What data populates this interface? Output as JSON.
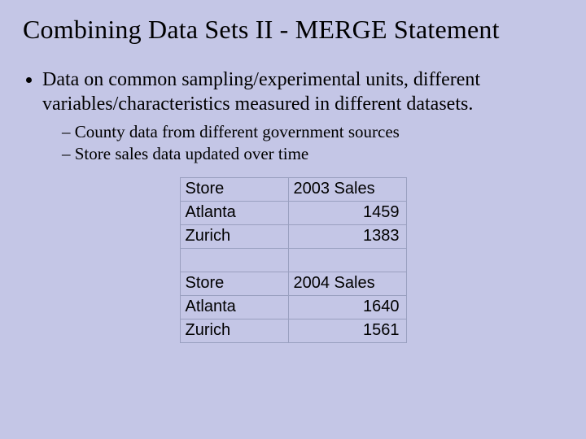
{
  "title": "Combining Data Sets II - MERGE Statement",
  "bullet": "Data on common sampling/experimental units, different variables/characteristics measured in different datasets.",
  "sub1": "County data from different government sources",
  "sub2": "Store sales data updated over time",
  "t": {
    "h1a": "Store",
    "h1b": "2003 Sales",
    "r1a": "Atlanta",
    "r1b": "1459",
    "r2a": "Zurich",
    "r2b": "1383",
    "h2a": "Store",
    "h2b": "2004 Sales",
    "r3a": "Atlanta",
    "r3b": "1640",
    "r4a": "Zurich",
    "r4b": "1561"
  },
  "chart_data": [
    {
      "type": "table",
      "title": "2003 Sales",
      "columns": [
        "Store",
        "2003 Sales"
      ],
      "rows": [
        [
          "Atlanta",
          1459
        ],
        [
          "Zurich",
          1383
        ]
      ]
    },
    {
      "type": "table",
      "title": "2004 Sales",
      "columns": [
        "Store",
        "2004 Sales"
      ],
      "rows": [
        [
          "Atlanta",
          1640
        ],
        [
          "Zurich",
          1561
        ]
      ]
    }
  ]
}
